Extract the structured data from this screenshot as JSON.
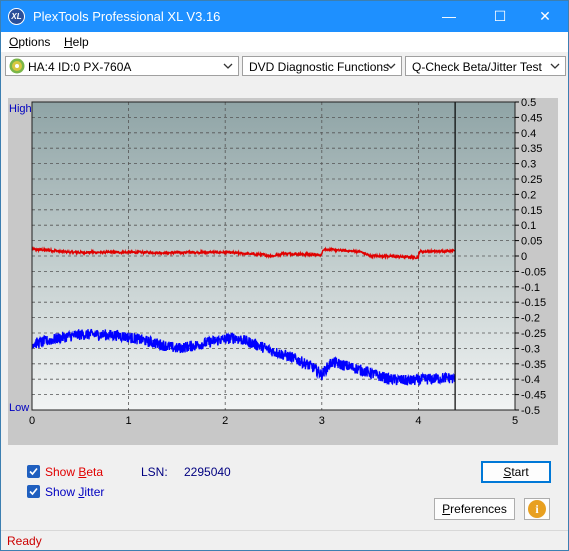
{
  "window": {
    "title": "PlexTools Professional XL V3.16",
    "app_icon_text": "XL",
    "minimize_glyph": "—",
    "maximize_glyph": "☐",
    "close_glyph": "✕"
  },
  "menu": {
    "options_label": "Options",
    "options_accel": "O",
    "options_rest": "ptions",
    "help_label": "Help",
    "help_accel": "H",
    "help_rest": "elp"
  },
  "toolbar": {
    "drive_value": "HA:4 ID:0  PX-760A",
    "function_value": "DVD Diagnostic Functions",
    "test_value": "Q-Check Beta/Jitter Test"
  },
  "chart_data": {
    "type": "line",
    "x_ticks": [
      "0",
      "1",
      "2",
      "3",
      "4",
      "5"
    ],
    "xlim": [
      0,
      5
    ],
    "right_axis_ticks": [
      "0.5",
      "0.45",
      "0.4",
      "0.35",
      "0.3",
      "0.25",
      "0.2",
      "0.15",
      "0.1",
      "0.05",
      "0",
      "-0.05",
      "-0.1",
      "-0.15",
      "-0.2",
      "-0.25",
      "-0.3",
      "-0.35",
      "-0.4",
      "-0.45",
      "-0.5"
    ],
    "ylim": [
      -0.5,
      0.5
    ],
    "left_top_label": "High",
    "left_bottom_label": "Low",
    "end_marker_x": 4.38,
    "grid": true,
    "series": [
      {
        "name": "Beta",
        "color": "#e00000",
        "x": [
          0.0,
          0.2,
          0.4,
          0.6,
          0.8,
          1.0,
          1.2,
          1.4,
          1.6,
          1.8,
          2.0,
          2.2,
          2.4,
          2.5,
          2.6,
          2.8,
          3.0,
          3.01,
          3.2,
          3.4,
          3.5,
          3.6,
          3.8,
          4.0,
          4.01,
          4.2,
          4.38
        ],
        "y": [
          0.022,
          0.018,
          0.012,
          0.012,
          0.012,
          0.012,
          0.012,
          0.01,
          0.012,
          0.012,
          0.012,
          0.008,
          0.004,
          0.0,
          0.008,
          0.006,
          0.003,
          0.022,
          0.018,
          0.014,
          0.0,
          0.0,
          -0.002,
          -0.005,
          0.015,
          0.015,
          0.018
        ],
        "jitter_amplitude": 0.004
      },
      {
        "name": "Jitter",
        "color": "#0000ff",
        "x": [
          0.0,
          0.1,
          0.3,
          0.5,
          0.7,
          0.9,
          1.1,
          1.3,
          1.5,
          1.7,
          1.9,
          2.0,
          2.1,
          2.3,
          2.5,
          2.7,
          2.9,
          3.0,
          3.1,
          3.3,
          3.5,
          3.7,
          3.9,
          4.1,
          4.3,
          4.38
        ],
        "y": [
          -0.285,
          -0.28,
          -0.265,
          -0.255,
          -0.255,
          -0.258,
          -0.27,
          -0.285,
          -0.3,
          -0.29,
          -0.275,
          -0.27,
          -0.265,
          -0.285,
          -0.31,
          -0.33,
          -0.36,
          -0.385,
          -0.345,
          -0.36,
          -0.38,
          -0.4,
          -0.405,
          -0.4,
          -0.395,
          -0.4
        ],
        "jitter_amplitude": 0.018
      }
    ]
  },
  "controls": {
    "show_beta_label": "Show Beta",
    "show_beta_pre": "Show ",
    "show_beta_accel": "B",
    "show_beta_rest": "eta",
    "show_beta_checked": true,
    "show_jitter_label": "Show Jitter",
    "show_jitter_pre": "Show ",
    "show_jitter_accel": "J",
    "show_jitter_rest": "itter",
    "show_jitter_checked": true,
    "lsn_label": "LSN:",
    "lsn_value": "2295040",
    "start_label": "Start",
    "start_accel": "S",
    "start_rest": "tart",
    "preferences_label": "Preferences",
    "preferences_accel": "P",
    "preferences_rest": "references",
    "info_glyph": "i"
  },
  "colors": {
    "titlebar": "#1e90ff",
    "beta_label": "#e00000",
    "jitter_label": "#0000c0",
    "status_text": "#cc0000",
    "checkbox": "#1f5fbf"
  },
  "status": {
    "text": "Ready"
  }
}
